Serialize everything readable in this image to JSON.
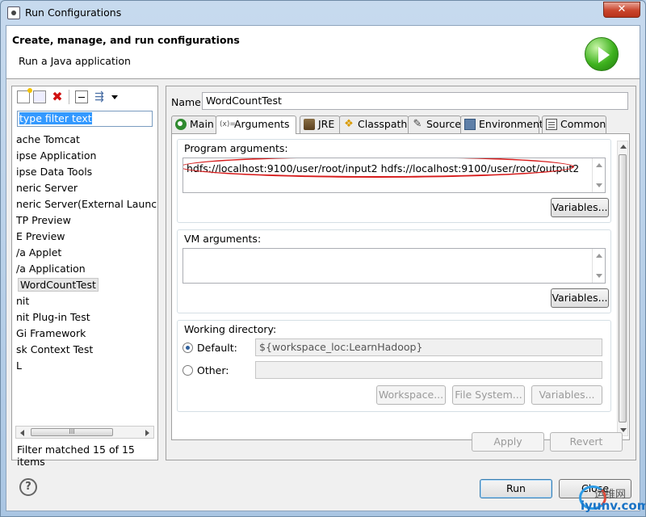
{
  "window": {
    "title": "Run Configurations",
    "close_glyph": "✕"
  },
  "header": {
    "title": "Create, manage, and run configurations",
    "subtitle": "Run a Java application"
  },
  "left": {
    "filter_placeholder": "type filter text",
    "tree": [
      "ache Tomcat",
      "ipse Application",
      "ipse Data Tools",
      "neric Server",
      "neric Server(External Launch)",
      "TP Preview",
      "E Preview",
      "/a Applet",
      "/a Application",
      "WordCountTest",
      "nit",
      "nit Plug-in Test",
      "Gi Framework",
      "sk Context Test",
      "L"
    ],
    "scroll_grip": "III",
    "status": "Filter matched 15 of 15 items"
  },
  "config": {
    "name_label": "Name:",
    "name_value": "WordCountTest",
    "tabs": [
      {
        "label": "Main",
        "icon": "main-tab-icon"
      },
      {
        "label": "Arguments",
        "icon": "arguments-tab-icon"
      },
      {
        "label": "JRE",
        "icon": "jre-tab-icon"
      },
      {
        "label": "Classpath",
        "icon": "classpath-tab-icon"
      },
      {
        "label": "Source",
        "icon": "source-tab-icon"
      },
      {
        "label": "Environment",
        "icon": "environment-tab-icon"
      },
      {
        "label": "Common",
        "icon": "common-tab-icon"
      }
    ],
    "active_tab": "Arguments",
    "args_icon_text": "(x)=",
    "program_args_label": "Program arguments:",
    "program_args_value": "hdfs://localhost:9100/user/root/input2 hdfs://localhost:9100/user/root/output2",
    "variables_label": "Variables...",
    "vm_args_label": "VM arguments:",
    "vm_args_value": "",
    "working_dir_label": "Working directory:",
    "default_label": "Default:",
    "default_value": "${workspace_loc:LearnHadoop}",
    "other_label": "Other:",
    "other_value": "",
    "workspace_btn": "Workspace...",
    "filesystem_btn": "File System...",
    "apply_btn": "Apply",
    "revert_btn": "Revert"
  },
  "footer": {
    "help_glyph": "?",
    "run_btn": "Run",
    "close_btn": "Close"
  },
  "watermark": {
    "text": "运维网",
    "url": "iyunv.com"
  },
  "colors": {
    "highlight_oval": "#d61a1a",
    "selection": "#3399ff",
    "run_green": "#3eb21e"
  }
}
